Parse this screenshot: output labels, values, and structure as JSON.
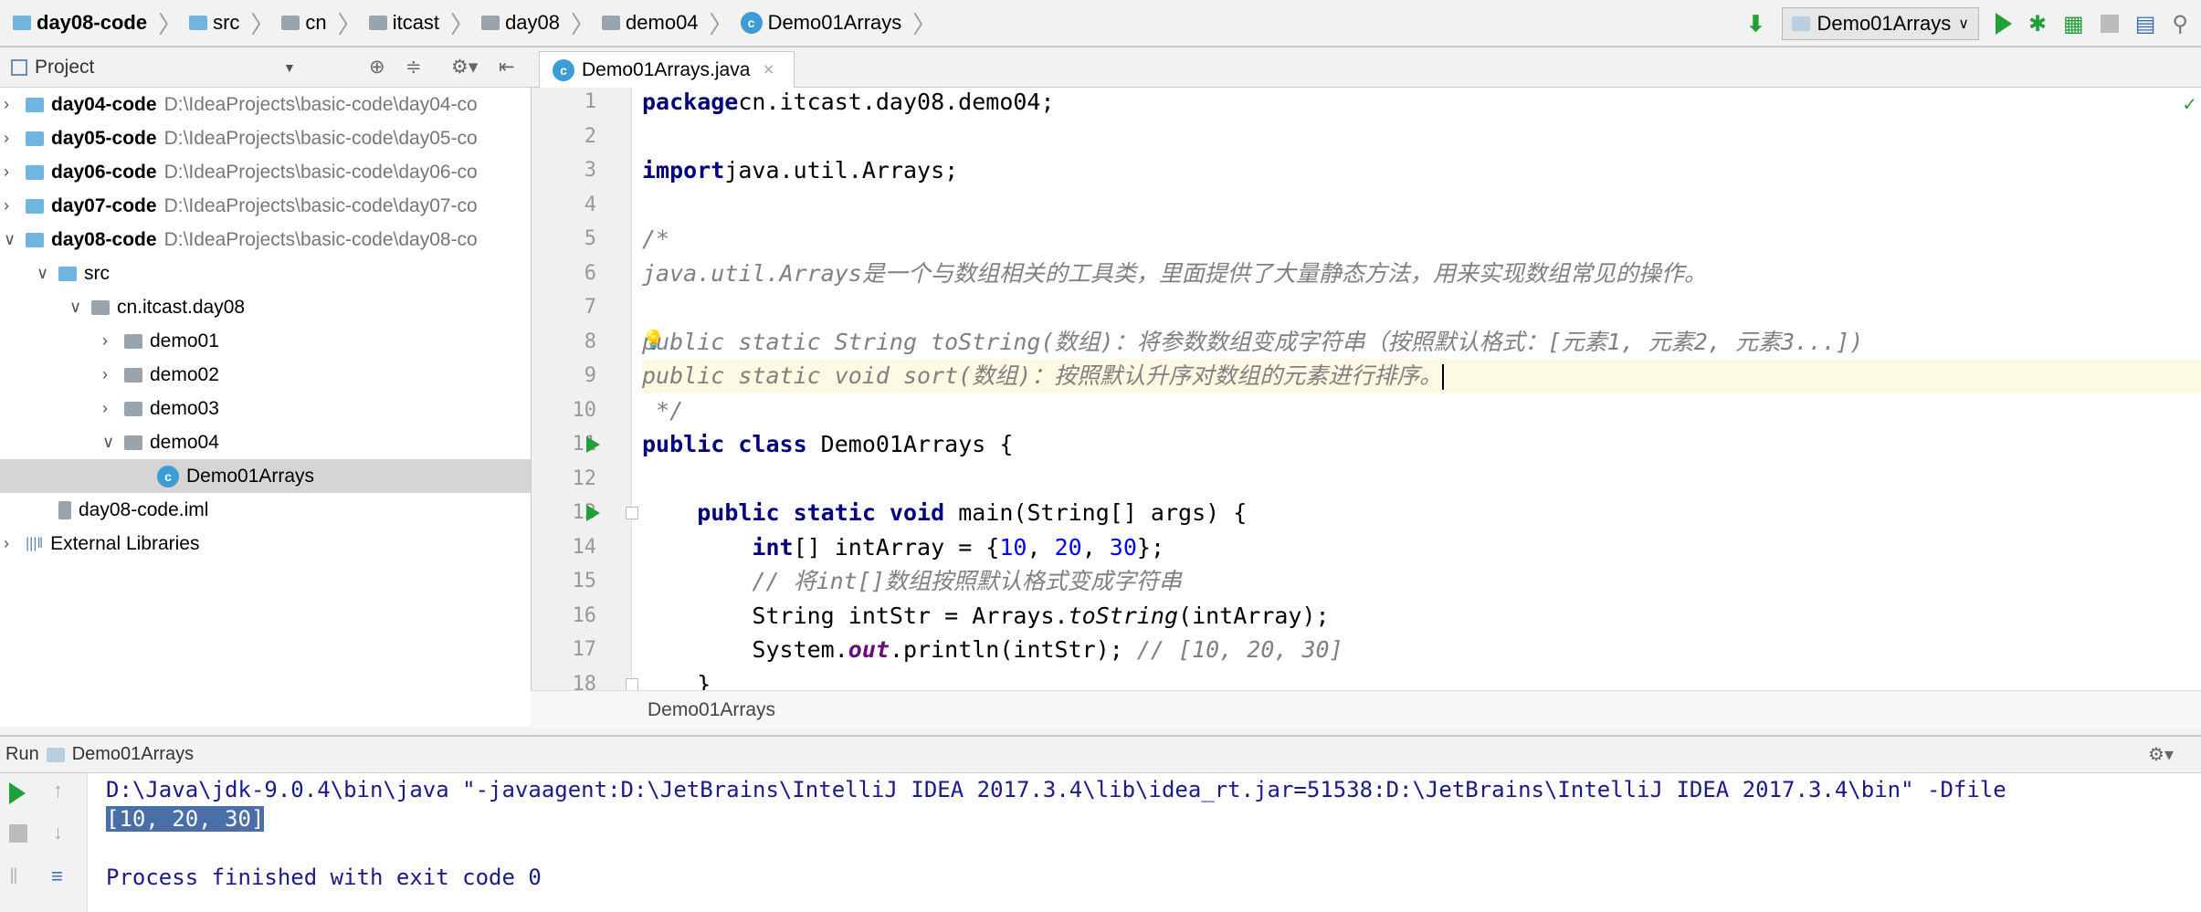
{
  "breadcrumb": [
    "day08-code",
    "src",
    "cn",
    "itcast",
    "day08",
    "demo04",
    "Demo01Arrays"
  ],
  "run_config": "Demo01Arrays",
  "project_panel": {
    "title": "Project"
  },
  "tree": [
    {
      "name": "day04-code",
      "path": "D:\\IdeaProjects\\basic-code\\day04-co",
      "level": 0,
      "expanded": false
    },
    {
      "name": "day05-code",
      "path": "D:\\IdeaProjects\\basic-code\\day05-co",
      "level": 0,
      "expanded": false
    },
    {
      "name": "day06-code",
      "path": "D:\\IdeaProjects\\basic-code\\day06-co",
      "level": 0,
      "expanded": false
    },
    {
      "name": "day07-code",
      "path": "D:\\IdeaProjects\\basic-code\\day07-co",
      "level": 0,
      "expanded": false
    },
    {
      "name": "day08-code",
      "path": "D:\\IdeaProjects\\basic-code\\day08-co",
      "level": 0,
      "expanded": true
    },
    {
      "name": "src",
      "level": 1,
      "expanded": true
    },
    {
      "name": "cn.itcast.day08",
      "level": 2,
      "expanded": true
    },
    {
      "name": "demo01",
      "level": 3,
      "expanded": false
    },
    {
      "name": "demo02",
      "level": 3,
      "expanded": false
    },
    {
      "name": "demo03",
      "level": 3,
      "expanded": false
    },
    {
      "name": "demo04",
      "level": 3,
      "expanded": true
    },
    {
      "name": "Demo01Arrays",
      "level": 4,
      "selected": true
    },
    {
      "name": "day08-code.iml",
      "level": 1
    },
    {
      "name": "External Libraries",
      "level": 0,
      "expanded": false
    }
  ],
  "editor": {
    "tab": "Demo01Arrays.java",
    "footer": "Demo01Arrays",
    "current_line": 9,
    "lines": [
      [
        [
          "kw",
          "package"
        ],
        [
          "",
          "cn.itcast.day08.demo04;"
        ]
      ],
      [],
      [
        [
          "kw",
          "import"
        ],
        [
          "",
          "java.util.Arrays;"
        ]
      ],
      [],
      [
        [
          "cm",
          "/*"
        ]
      ],
      [
        [
          "cm",
          "java.util.Arrays是一个与数组相关的工具类，里面提供了大量静态方法，用来实现数组常见的操作。"
        ]
      ],
      [],
      [
        [
          "cm",
          "public static String toString(数组)：将参数数组变成字符串（按照默认格式：[元素1, 元素2, 元素3...])"
        ]
      ],
      [
        [
          "cm",
          "public static void sort(数组)：按照默认升序对数组的元素进行排序。"
        ]
      ],
      [
        [
          "cm",
          " */"
        ]
      ],
      [
        [
          "kw",
          "public class"
        ],
        [
          "",
          " Demo01Arrays {"
        ]
      ],
      [],
      [
        [
          "",
          "    "
        ],
        [
          "kw",
          "public static void"
        ],
        [
          "",
          " main(String[] args) {"
        ]
      ],
      [
        [
          "",
          "        "
        ],
        [
          "kw",
          "int"
        ],
        [
          "",
          "[] intArray = {"
        ],
        [
          "num",
          "10"
        ],
        [
          "",
          ", "
        ],
        [
          "num",
          "20"
        ],
        [
          "",
          ", "
        ],
        [
          "num",
          "30"
        ],
        [
          "",
          "};"
        ]
      ],
      [
        [
          "cm",
          "        // 将int[]数组按照默认格式变成字符串"
        ]
      ],
      [
        [
          "",
          "        String intStr = Arrays."
        ],
        [
          "fn",
          "toString"
        ],
        [
          "",
          "(intArray);"
        ]
      ],
      [
        [
          "",
          "        System."
        ],
        [
          "sf",
          "out"
        ],
        [
          "",
          ".println(intStr); "
        ],
        [
          "cm",
          "// [10, 20, 30]"
        ]
      ],
      [
        [
          "",
          "    }"
        ]
      ],
      [],
      [
        [
          "",
          "}"
        ]
      ]
    ]
  },
  "run_panel": {
    "label": "Run",
    "config": "Demo01Arrays",
    "output": [
      "D:\\Java\\jdk-9.0.4\\bin\\java \"-javaagent:D:\\JetBrains\\IntelliJ IDEA 2017.3.4\\lib\\idea_rt.jar=51538:D:\\JetBrains\\IntelliJ IDEA 2017.3.4\\bin\" -Dfile",
      "[10, 20, 30]",
      "",
      "Process finished with exit code 0"
    ]
  },
  "colors": {
    "keyword": "#000080",
    "comment": "#808080",
    "number": "#0000ff",
    "console": "#1a1a8c",
    "run_green": "#21a038"
  }
}
